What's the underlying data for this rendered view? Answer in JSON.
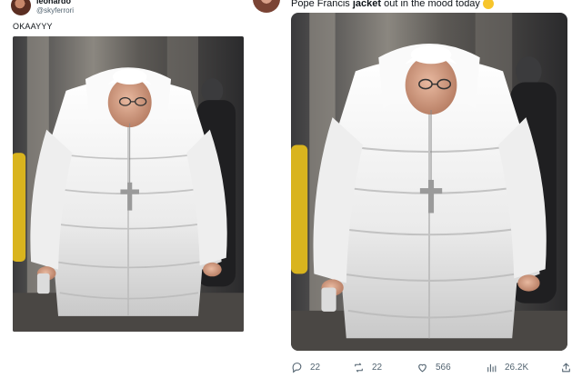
{
  "left_tweet": {
    "display_name": "leonardo",
    "handle": "@skyferrori",
    "text": "OKAAYYY"
  },
  "right_tweet": {
    "text_prefix": "Pope Francis ",
    "text_bold": "jacket",
    "text_suffix": " out in the mood today",
    "actions": {
      "replies": "22",
      "retweets": "22",
      "likes": "566",
      "views": "26.2K"
    }
  },
  "icons": {
    "reply": "reply-icon",
    "retweet": "retweet-icon",
    "like": "heart-icon",
    "views": "views-icon",
    "share": "share-icon"
  },
  "colors": {
    "text_primary": "#0f1419",
    "text_secondary": "#536471",
    "photo_background": "#2c2c2e",
    "jacket": "#f2f2f2"
  }
}
